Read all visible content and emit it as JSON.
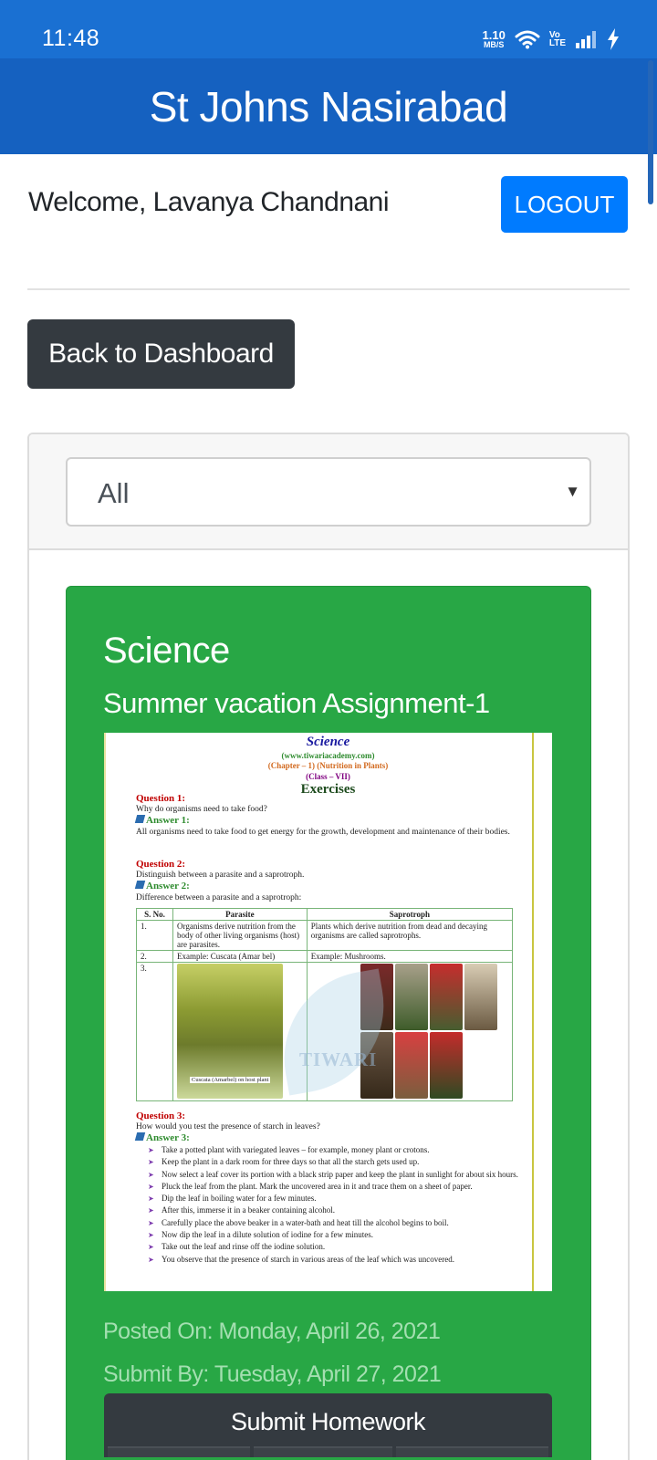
{
  "status_bar": {
    "time": "11:48",
    "net_speed_value": "1.10",
    "net_speed_unit": "MB/S",
    "volte_top": "Vo",
    "volte_bottom": "LTE"
  },
  "header": {
    "title": "St Johns Nasirabad"
  },
  "user": {
    "welcome": "Welcome, Lavanya Chandnani",
    "logout_label": "LOGOUT"
  },
  "nav": {
    "back_label": "Back to Dashboard"
  },
  "filter": {
    "selected": "All"
  },
  "homework": {
    "subject": "Science",
    "title": "Summer vacation Assignment-1",
    "posted_on": "Posted On: Monday, April 26, 2021",
    "submit_by": "Submit By: Tuesday, April 27, 2021",
    "submit_label": "Submit Homework"
  },
  "attachment": {
    "title": "Science",
    "url": "(www.tiwariacademy.com)",
    "chapter": "(Chapter – 1) (Nutrition in Plants)",
    "class": "(Class – VII)",
    "heading": "Exercises",
    "q1_label": "Question 1:",
    "q1_text": "Why do organisms need to take food?",
    "a1_label": "Answer 1:",
    "a1_text": "All organisms need to take food to get energy for the growth, development and maintenance of their bodies.",
    "q2_label": "Question 2:",
    "q2_text": "Distinguish between a parasite and a saprotroph.",
    "a2_label": "Answer 2:",
    "a2_text": "Difference between a parasite and a saprotroph:",
    "table_headers": [
      "S. No.",
      "Parasite",
      "Saprotroph"
    ],
    "row1": [
      "1.",
      "Organisms derive nutrition from the body of other living organisms (host) are parasites.",
      "Plants which derive nutrition from dead and decaying organisms are called saprotrophs."
    ],
    "row2": [
      "2.",
      "Example: Cuscata (Amar bel)",
      "Example: Mushrooms."
    ],
    "row3_no": "3.",
    "tree_caption": "Cuscata (Amarbel) on host plant",
    "watermark": "TIWARI",
    "q3_label": "Question 3:",
    "q3_text": "How would you test the presence of starch in leaves?",
    "a3_label": "Answer 3:",
    "steps": [
      "Take a potted plant with variegated leaves – for example, money plant or crotons.",
      "Keep the plant in a dark room for three days so that all the starch gets used up.",
      "Now select a leaf cover its portion with a black strip paper and keep the plant in sunlight for about six hours.",
      "Pluck the leaf from the plant. Mark the uncovered area in it and trace them on a sheet of paper.",
      "Dip the leaf in boiling water for a few minutes.",
      "After this, immerse it in a beaker containing alcohol.",
      "Carefully place the above beaker in a water-bath and heat till the alcohol begins to boil.",
      "Now dip the leaf in a dilute solution of iodine for a few minutes.",
      "Take out the leaf and rinse off the iodine solution.",
      "You observe that the presence of starch in various areas of the leaf which was uncovered."
    ]
  },
  "colors": {
    "status_bar": "#1a70d2",
    "header": "#1561c0",
    "logout": "#007bff",
    "dark_button": "#343a40",
    "homework_card": "#28a745"
  }
}
